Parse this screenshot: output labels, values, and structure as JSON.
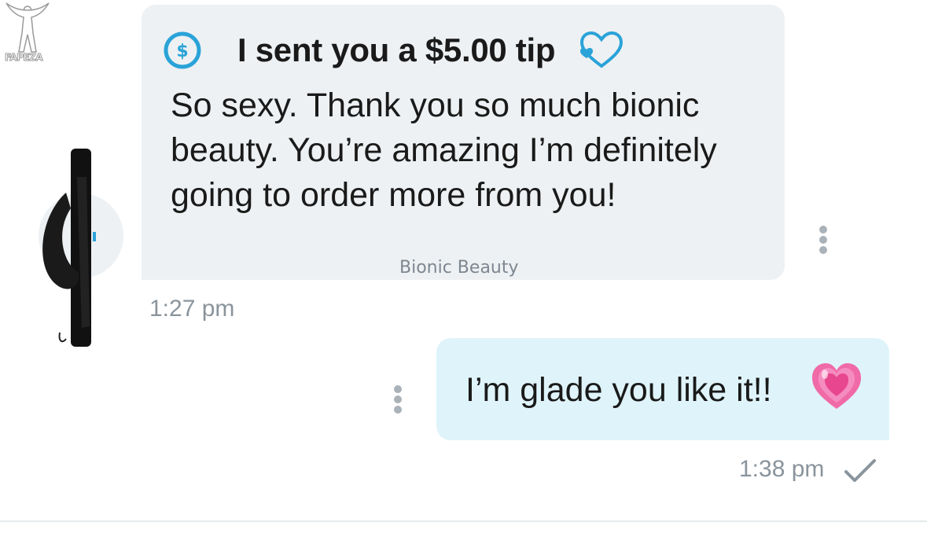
{
  "watermark": {
    "text": "FAPEZA"
  },
  "conversation": {
    "incoming": {
      "tip_text": "I sent you a $5.00 tip",
      "message": "So sexy. Thank you so much bionic beauty. You’re amazing I’m definitely going to order more from you!",
      "sender": "Bionic Beauty",
      "time": "1:27 pm",
      "icons": [
        "dollar-icon",
        "heart-outline-icon",
        "more-options-icon"
      ]
    },
    "outgoing": {
      "message": "I’m glade you like it!!",
      "emoji": "growing-heart-emoji",
      "time": "1:38 pm",
      "status": "sent",
      "icons": [
        "more-options-icon",
        "checkmark-icon"
      ]
    }
  },
  "colors": {
    "accent": "#2aa3d8",
    "incoming_bubble": "#eef1f3",
    "outgoing_bubble": "#dff4fa",
    "timestamp": "#8a949c"
  }
}
